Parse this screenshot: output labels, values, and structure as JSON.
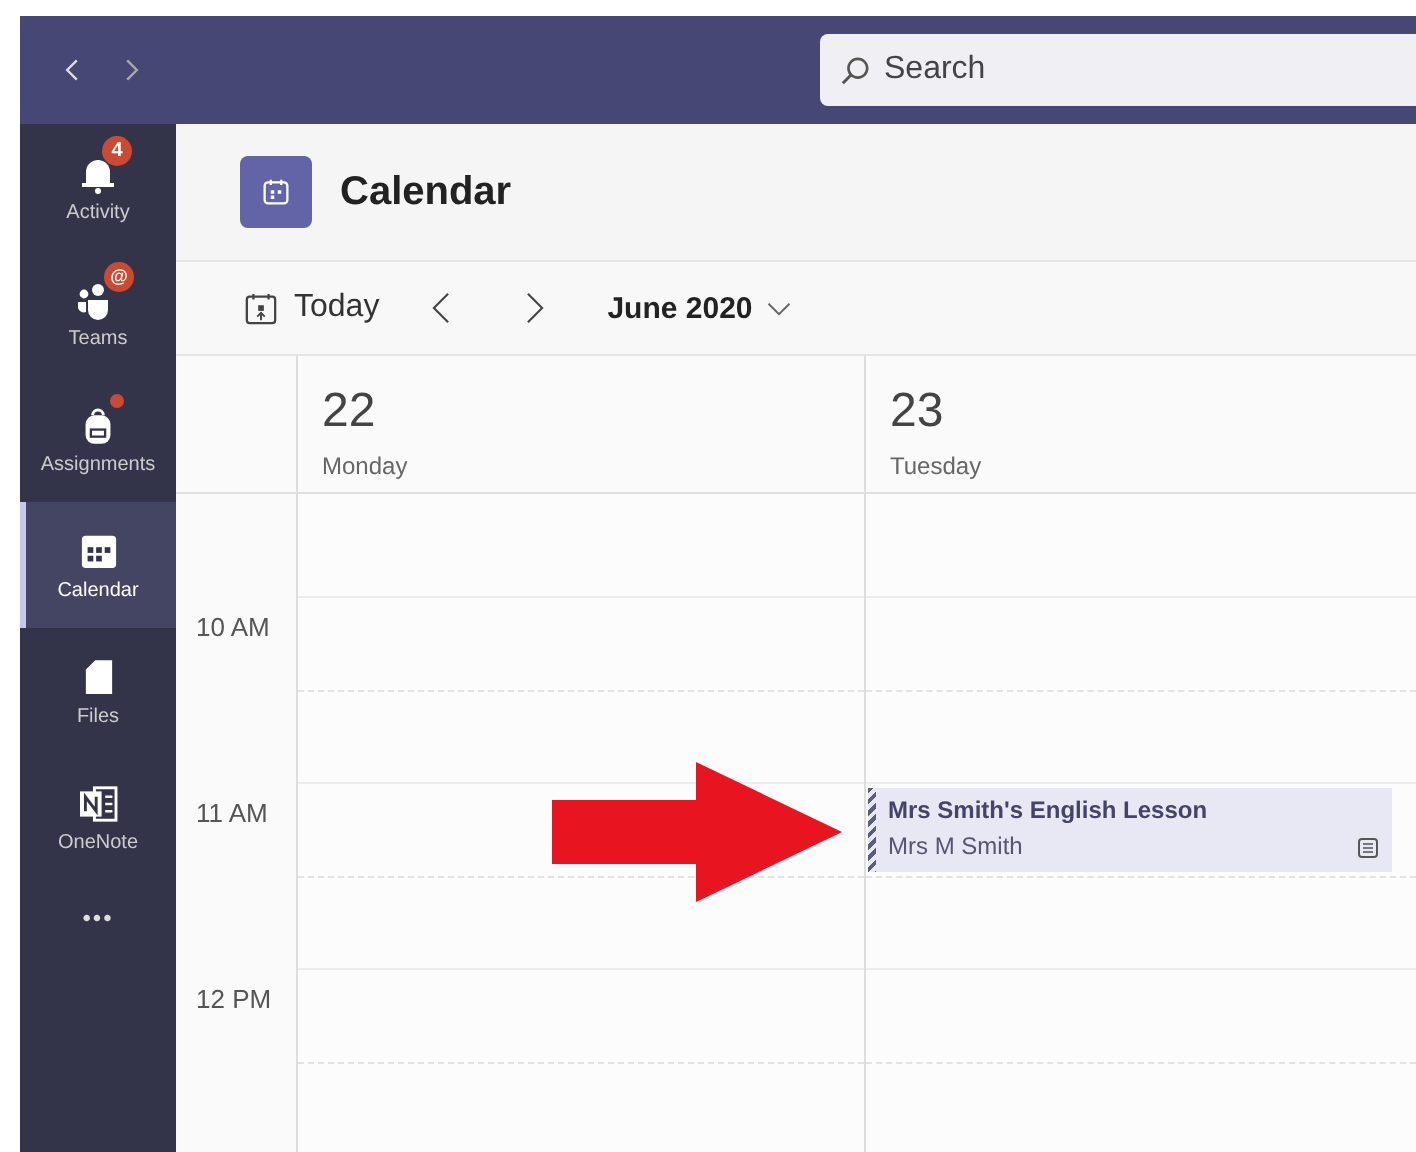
{
  "search": {
    "placeholder": "Search"
  },
  "sidebar": {
    "items": [
      {
        "label": "Activity",
        "selected": false,
        "badge": {
          "kind": "count",
          "text": "4"
        }
      },
      {
        "label": "Teams",
        "selected": false,
        "badge": {
          "kind": "mention",
          "text": "@"
        }
      },
      {
        "label": "Assignments",
        "selected": false,
        "badge": {
          "kind": "dot"
        }
      },
      {
        "label": "Calendar",
        "selected": true
      },
      {
        "label": "Files",
        "selected": false
      },
      {
        "label": "OneNote",
        "selected": false
      }
    ],
    "more": "•••"
  },
  "header": {
    "title": "Calendar"
  },
  "toolbar": {
    "today": "Today",
    "month": "June 2020"
  },
  "hours": [
    "10 AM",
    "11 AM",
    "12 PM"
  ],
  "days": [
    {
      "number": "22",
      "weekday": "Monday"
    },
    {
      "number": "23",
      "weekday": "Tuesday",
      "events": [
        {
          "title": "Mrs Smith's English Lesson",
          "organizer": "Mrs M Smith"
        }
      ]
    }
  ]
}
